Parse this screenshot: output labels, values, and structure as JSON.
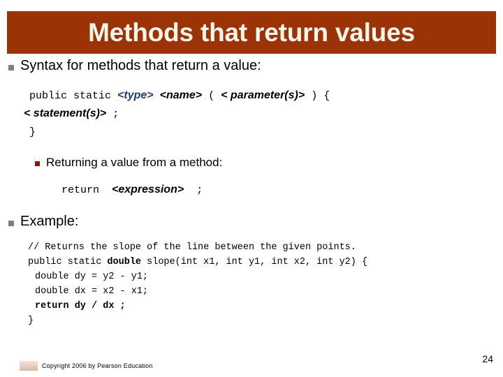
{
  "slide": {
    "title": "Methods that return values",
    "title_bar_color": "#9C3306",
    "title_text_color": "#FBF6EC"
  },
  "bullets": {
    "syntax_heading": "Syntax for methods that return a value:",
    "returning_heading": "Returning a value from a method:",
    "example_heading": "Example:"
  },
  "syntax_code": {
    "line1": {
      "part1": "public static ",
      "type_placeholder": "<type>",
      "space1": " ",
      "name_placeholder": "<name>",
      "paren_open": " ( ",
      "param_placeholder": "< parameter(s)>",
      "paren_close": " ) {"
    },
    "line2": {
      "statement_placeholder": "< statement(s)>",
      "semicolon": " ;"
    },
    "line3": "}"
  },
  "return_code": {
    "keyword": "return  ",
    "expression_placeholder": "<expression>",
    "semicolon": "  ;"
  },
  "example_code": {
    "comment": "// Returns the slope of the line between the given points.",
    "decl_pre": "public static ",
    "decl_type": "double",
    "decl_post": " slope(int x1, int y1, int x2, int y2) {",
    "body1": "double dy = y2 - y1;",
    "body2": "double dx = x2 - x1;",
    "body3": "return dy / dx ;",
    "close_brace": "}"
  },
  "footer": {
    "copyright": "Copyright 2006 by Pearson Education",
    "page_number": "24"
  }
}
